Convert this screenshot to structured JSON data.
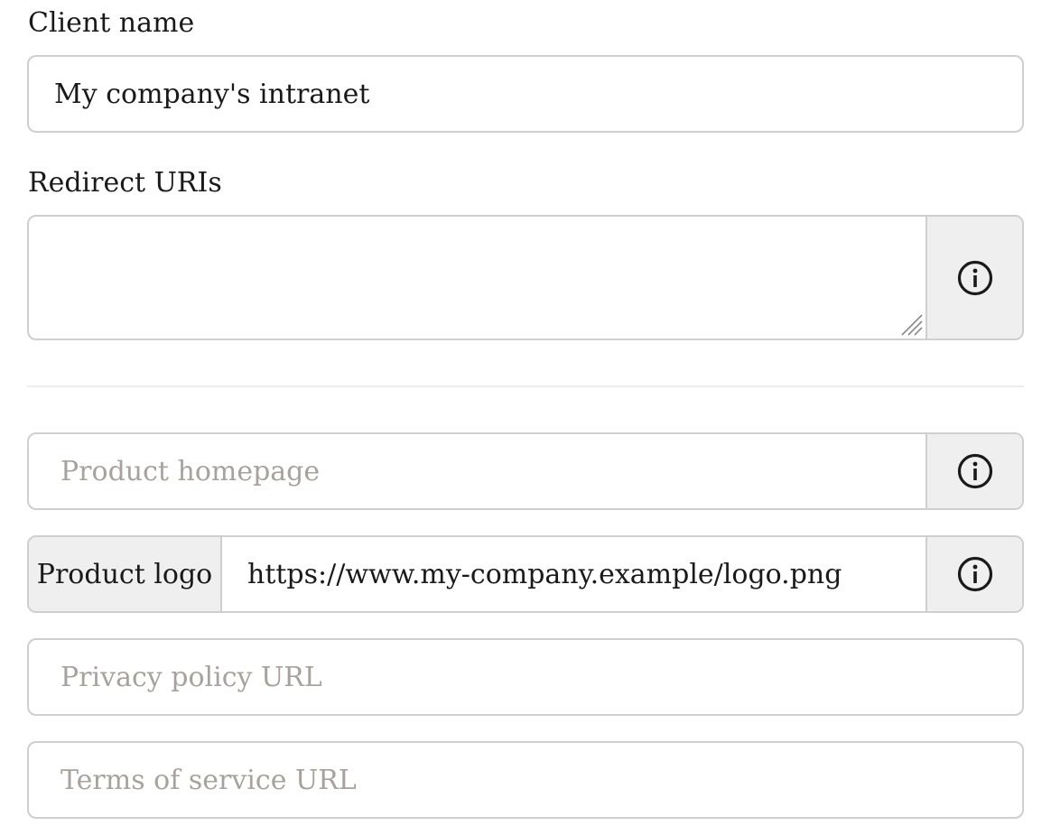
{
  "client_name": {
    "label": "Client name",
    "value": "My company's intranet"
  },
  "redirect_uris": {
    "label": "Redirect URIs",
    "value": "",
    "info_icon": "info-circle-icon"
  },
  "product_homepage": {
    "placeholder": "Product homepage",
    "info_icon": "info-circle-icon"
  },
  "product_logo": {
    "addon_label": "Product logo",
    "value": "https://www.my-company.example/logo.png",
    "info_icon": "info-circle-icon"
  },
  "privacy_policy": {
    "placeholder": "Privacy policy URL"
  },
  "terms_of_service": {
    "placeholder": "Terms of service URL"
  },
  "colors": {
    "border": "#cfcfcf",
    "addon_bg": "#efefef",
    "placeholder": "#a8a29f",
    "text": "#1a1a1a"
  }
}
